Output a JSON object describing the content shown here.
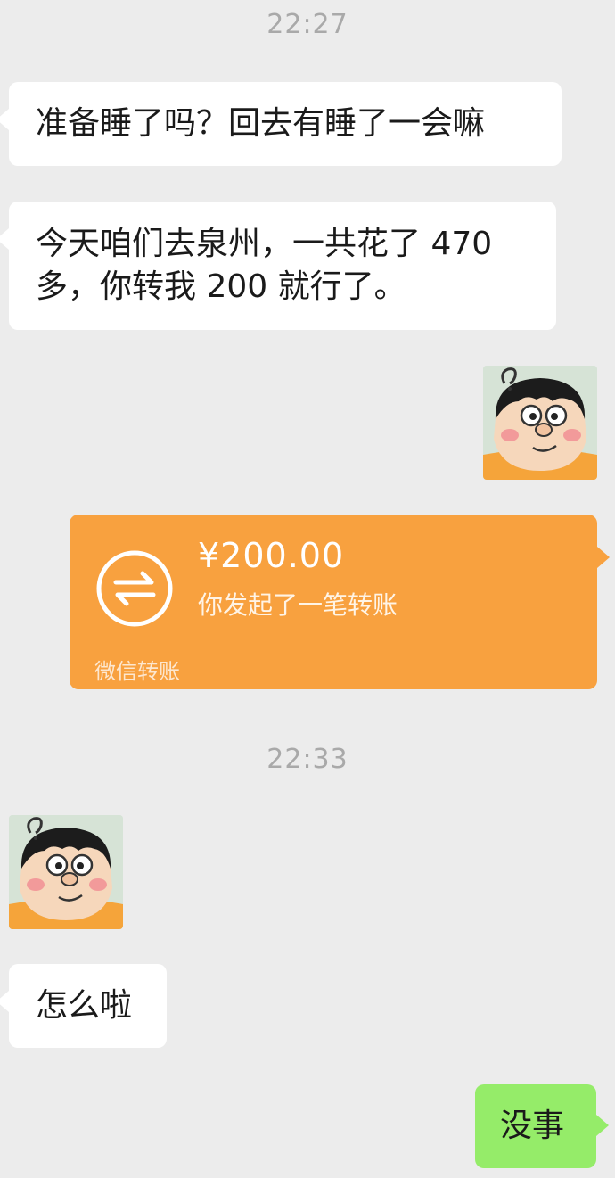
{
  "chat": {
    "time_1": "22:27",
    "msg_1": "准备睡了吗？回去有睡了一会嘛",
    "msg_2_line1": "今天咱们去泉州，一共花了 470",
    "msg_2_line2": "多，你转我 200 就行了。",
    "transfer": {
      "amount": "¥200.00",
      "desc": "你发起了一笔转账",
      "footer": "微信转账"
    },
    "time_2": "22:33",
    "msg_3": "怎么啦",
    "msg_4": "没事"
  },
  "avatar_icon": "cartoon-character-avatar-icon",
  "transfer_icon": "transfer-arrows-icon",
  "colors": {
    "background": "#ececec",
    "bubble_white": "#ffffff",
    "bubble_green": "#95ec69",
    "transfer_orange": "#f8a13f",
    "timestamp": "#a9a9a9"
  }
}
